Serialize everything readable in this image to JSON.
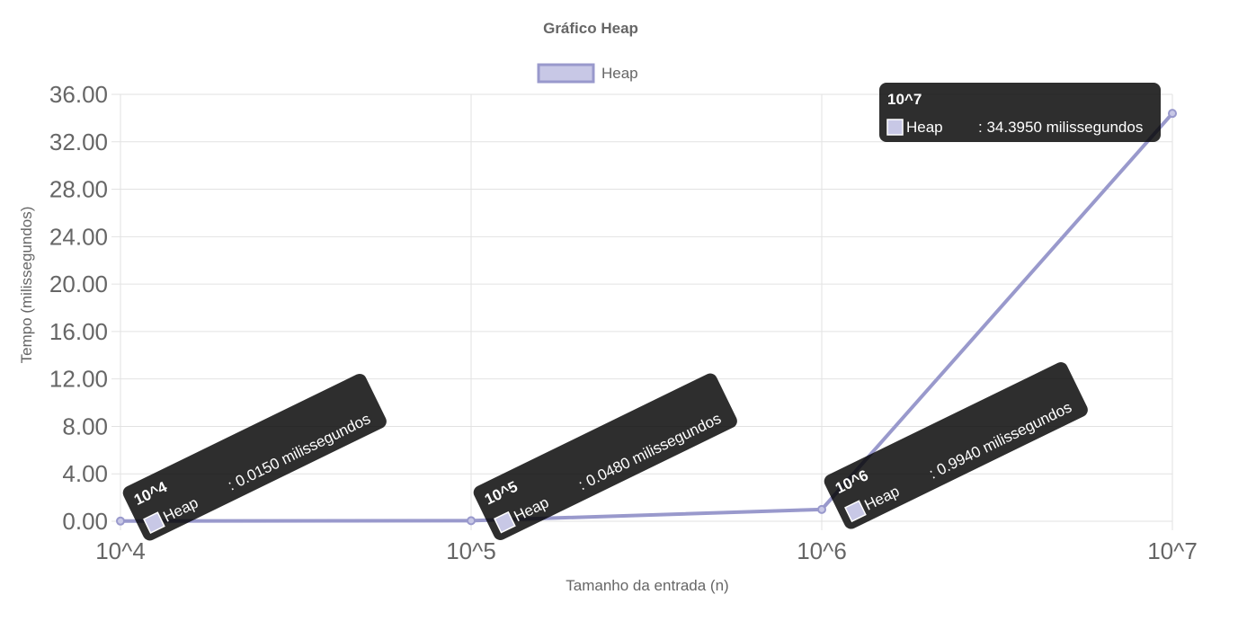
{
  "chart_data": {
    "type": "line",
    "title": "Gráfico Heap",
    "xlabel": "Tamanho da entrada (n)",
    "ylabel": "Tempo (milissegundos)",
    "categories": [
      "10^4",
      "10^5",
      "10^6",
      "10^7"
    ],
    "series": [
      {
        "name": "Heap",
        "values": [
          0.015,
          0.048,
          0.994,
          34.395
        ]
      }
    ],
    "ylim": [
      0,
      36
    ],
    "y_ticks": [
      "0.00",
      "4.00",
      "8.00",
      "12.00",
      "16.00",
      "20.00",
      "24.00",
      "28.00",
      "32.00",
      "36.00"
    ],
    "grid": true,
    "legend": "top",
    "line_color": "#9999cc",
    "fill_color": "#c8c8e6",
    "tooltips": [
      {
        "title": "10^4",
        "series": "Heap",
        "value_text": ": 0.0150 milissegundos"
      },
      {
        "title": "10^5",
        "series": "Heap",
        "value_text": ": 0.0480 milissegundos"
      },
      {
        "title": "10^6",
        "series": "Heap",
        "value_text": ": 0.9940 milissegundos"
      },
      {
        "title": "10^7",
        "series": "Heap",
        "value_text": ": 34.3950 milissegundos"
      }
    ]
  }
}
